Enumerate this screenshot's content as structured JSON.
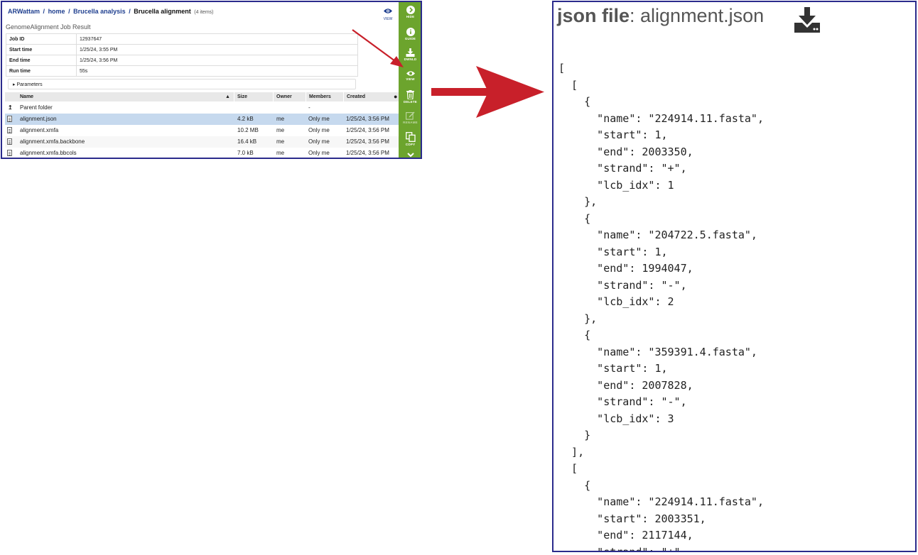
{
  "workspace": {
    "breadcrumb": {
      "user": "ARWattam",
      "sep": "/",
      "home": "home",
      "folder": "Brucella analysis",
      "current": "Brucella alignment",
      "count": "(4 items)"
    },
    "view_label": "VIEW",
    "job_title": "GenomeAlignment Job Result",
    "job_info": [
      {
        "key": "Job ID",
        "value": "12937647"
      },
      {
        "key": "Start time",
        "value": "1/25/24, 3:55 PM"
      },
      {
        "key": "End time",
        "value": "1/25/24, 3:56 PM"
      },
      {
        "key": "Run time",
        "value": "55s"
      }
    ],
    "parameters_label": "Parameters",
    "columns": {
      "name": "Name",
      "size": "Size",
      "owner": "Owner",
      "members": "Members",
      "created": "Created"
    },
    "parent_folder": {
      "name": "Parent folder",
      "members": "-"
    },
    "files": [
      {
        "name": "alignment.json",
        "size": "4.2 kB",
        "owner": "me",
        "members": "Only me",
        "created": "1/25/24, 3:56 PM",
        "selected": true
      },
      {
        "name": "alignment.xmfa",
        "size": "10.2 MB",
        "owner": "me",
        "members": "Only me",
        "created": "1/25/24, 3:56 PM"
      },
      {
        "name": "alignment.xmfa.backbone",
        "size": "16.4 kB",
        "owner": "me",
        "members": "Only me",
        "created": "1/25/24, 3:56 PM"
      },
      {
        "name": "alignment.xmfa.bbcols",
        "size": "7.0 kB",
        "owner": "me",
        "members": "Only me",
        "created": "1/25/24, 3:56 PM"
      }
    ],
    "actions": {
      "hide": "HIDE",
      "guide": "GUIDE",
      "download": "DWNLD",
      "view": "VIEW",
      "delete": "DELETE",
      "rename": "RENAME",
      "copy": "COPY"
    },
    "colors": {
      "accent": "#6ca42d",
      "link": "#1f3f8f",
      "selected_row": "#c6d9ee",
      "border": "#2b2b8c",
      "arrow": "#c8202a"
    }
  },
  "viewer": {
    "title_bold": "json file",
    "title_rest": ": alignment.json",
    "download_icon": "download-icon",
    "content": "[\n  [\n    {\n      \"name\": \"224914.11.fasta\",\n      \"start\": 1,\n      \"end\": 2003350,\n      \"strand\": \"+\",\n      \"lcb_idx\": 1\n    },\n    {\n      \"name\": \"204722.5.fasta\",\n      \"start\": 1,\n      \"end\": 1994047,\n      \"strand\": \"-\",\n      \"lcb_idx\": 2\n    },\n    {\n      \"name\": \"359391.4.fasta\",\n      \"start\": 1,\n      \"end\": 2007828,\n      \"strand\": \"-\",\n      \"lcb_idx\": 3\n    }\n  ],\n  [\n    {\n      \"name\": \"224914.11.fasta\",\n      \"start\": 2003351,\n      \"end\": 2117144,\n      \"strand\": \"+\","
  }
}
